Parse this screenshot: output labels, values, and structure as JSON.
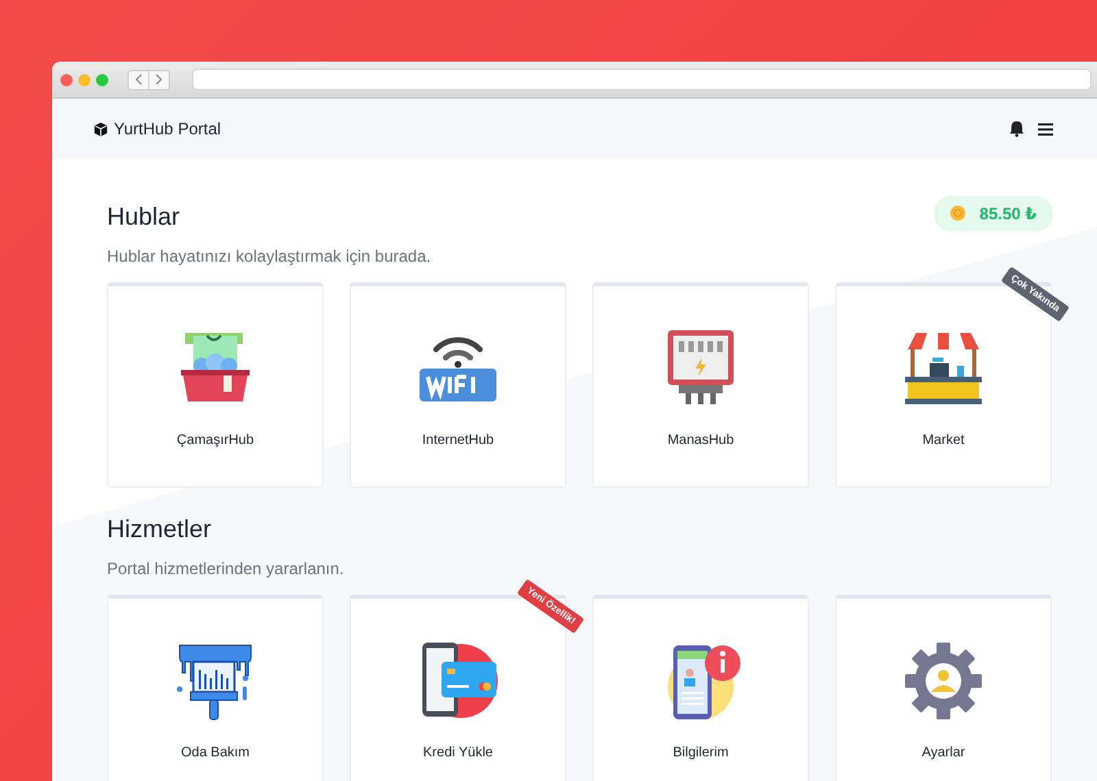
{
  "brand": {
    "name": "YurtHub Portal"
  },
  "balance": {
    "amount": "85.50 ₺"
  },
  "sections": [
    {
      "title": "Hublar",
      "subtitle": "Hublar hayatınızı kolaylaştırmak için burada.",
      "cards": [
        {
          "label": "ÇamaşırHub"
        },
        {
          "label": "InternetHub"
        },
        {
          "label": "ManasHub"
        },
        {
          "label": "Market",
          "badge": {
            "text": "Çok Yakında",
            "kind": "soon"
          }
        }
      ]
    },
    {
      "title": "Hizmetler",
      "subtitle": "Portal hizmetlerinden yararlanın.",
      "cards": [
        {
          "label": "Oda Bakım"
        },
        {
          "label": "Kredi Yükle",
          "badge": {
            "text": "Yeni Özellik!",
            "kind": "new"
          }
        },
        {
          "label": "Bilgilerim"
        },
        {
          "label": "Ayarlar"
        }
      ]
    }
  ]
}
